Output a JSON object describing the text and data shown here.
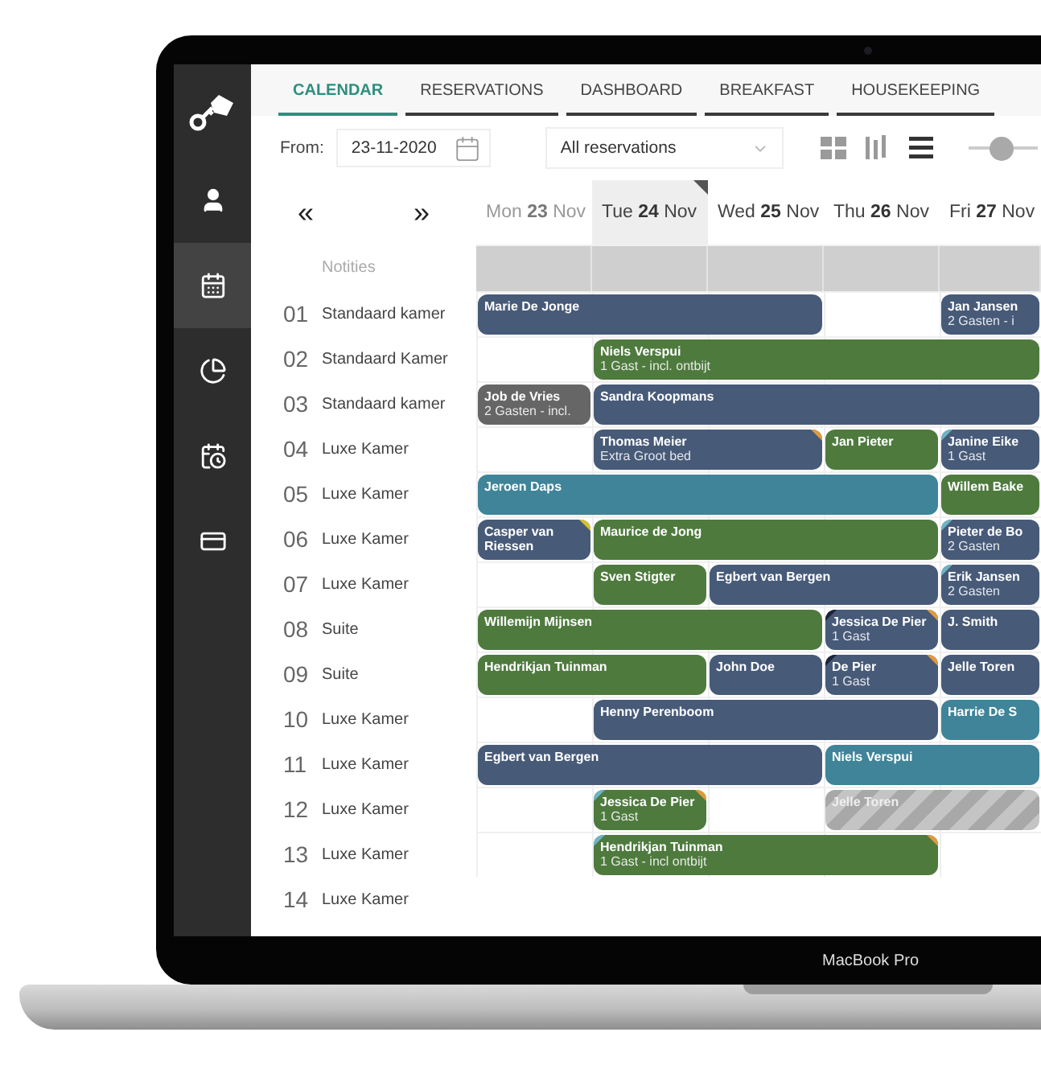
{
  "device": {
    "label": "MacBook Pro"
  },
  "sidebar": {
    "items": [
      {
        "kind": "guests",
        "selected": false
      },
      {
        "kind": "calendar",
        "selected": true
      },
      {
        "kind": "reports",
        "selected": false
      },
      {
        "kind": "schedule",
        "selected": false
      },
      {
        "kind": "payments",
        "selected": false
      }
    ]
  },
  "tabs": [
    {
      "label": "CALENDAR",
      "selected": true
    },
    {
      "label": "RESERVATIONS",
      "selected": false
    },
    {
      "label": "DASHBOARD",
      "selected": false
    },
    {
      "label": "BREAKFAST",
      "selected": false
    },
    {
      "label": "HOUSEKEEPING",
      "selected": false
    }
  ],
  "toolbar": {
    "from_label": "From:",
    "date": "23-11-2020",
    "filter": "All reservations",
    "views": [
      {
        "kind": "grid",
        "selected": false
      },
      {
        "kind": "columns",
        "selected": false
      },
      {
        "kind": "list",
        "selected": true
      }
    ],
    "zoom_slider": {
      "level": 0.45
    }
  },
  "nav": {
    "previous": "«",
    "next": "»"
  },
  "days": [
    {
      "weekday": "Mon",
      "day": "23",
      "month": "Nov",
      "selected": false,
      "past": true
    },
    {
      "weekday": "Tue",
      "day": "24",
      "month": "Nov",
      "selected": true,
      "past": false
    },
    {
      "weekday": "Wed",
      "day": "25",
      "month": "Nov",
      "selected": false,
      "past": false
    },
    {
      "weekday": "Thu",
      "day": "26",
      "month": "Nov",
      "selected": false,
      "past": false
    },
    {
      "weekday": "Fri",
      "day": "27",
      "month": "Nov",
      "selected": false,
      "past": false
    }
  ],
  "notes_label": "Notities",
  "rooms": [
    {
      "number": "01",
      "name": "Standaard kamer",
      "bookings": [
        {
          "kind": "booking",
          "guest": "Marie De Jonge",
          "color": "#475a78"
        },
        {
          "kind": "booking",
          "guest": "Jan Jansen",
          "detail": "2 Gasten - i",
          "color": "#475a78"
        }
      ]
    },
    {
      "number": "02",
      "name": "Standaard Kamer",
      "bookings": [
        {
          "kind": "booking",
          "guest": "Niels Verspui",
          "detail": "1 Gast - incl. ontbijt",
          "color": "#4e7a3e"
        }
      ]
    },
    {
      "number": "03",
      "name": "Standaard kamer",
      "bookings": [
        {
          "kind": "booking",
          "guest": "Job de Vries",
          "detail": "2 Gasten - incl.",
          "color": "#666666"
        },
        {
          "kind": "booking",
          "guest": "Sandra Koopmans",
          "color": "#475a78"
        }
      ]
    },
    {
      "number": "04",
      "name": "Luxe Kamer",
      "bookings": [
        {
          "kind": "booking",
          "guest": "Thomas Meier",
          "detail": "Extra Groot bed",
          "color": "#475a78",
          "end_flag": {
            "color": "#e09a3e"
          }
        },
        {
          "kind": "booking",
          "guest": "Jan Pieter",
          "color": "#4e7a3e"
        },
        {
          "kind": "booking",
          "guest": "Janine Eike",
          "detail": "1 Gast",
          "color": "#475a78",
          "start_flag": {
            "color": "#6fb3c4"
          }
        }
      ]
    },
    {
      "number": "05",
      "name": "Luxe Kamer",
      "bookings": [
        {
          "kind": "booking",
          "guest": "Jeroen Daps",
          "color": "#3f8499"
        },
        {
          "kind": "booking",
          "guest": "Willem Bake",
          "color": "#4e7a3e"
        }
      ]
    },
    {
      "number": "06",
      "name": "Luxe Kamer",
      "bookings": [
        {
          "kind": "booking",
          "guest": "Casper van Riessen",
          "color": "#475a78",
          "end_flag": {
            "color": "#d9c12a"
          }
        },
        {
          "kind": "booking",
          "guest": "Maurice de Jong",
          "color": "#4e7a3e"
        },
        {
          "kind": "booking",
          "guest": "Pieter de Bo",
          "detail": "2 Gasten",
          "color": "#475a78",
          "start_flag": {
            "color": "#6fb3c4"
          }
        }
      ]
    },
    {
      "number": "07",
      "name": "Luxe Kamer",
      "bookings": [
        {
          "kind": "booking",
          "guest": "Sven Stigter",
          "color": "#4e7a3e"
        },
        {
          "kind": "booking",
          "guest": "Egbert van Bergen",
          "color": "#475a78"
        },
        {
          "kind": "booking",
          "guest": "Erik Jansen",
          "detail": "2 Gasten",
          "color": "#475a78",
          "start_flag": {
            "color": "#6fb3c4"
          }
        }
      ]
    },
    {
      "number": "08",
      "name": "Suite",
      "bookings": [
        {
          "kind": "booking",
          "guest": "Willemijn Mijnsen",
          "color": "#4e7a3e"
        },
        {
          "kind": "booking",
          "guest": "Jessica De Pier",
          "detail": "1 Gast",
          "color": "#475a78",
          "start_flag": {
            "color": "#1b2438"
          },
          "end_flag": {
            "color": "#e09a3e"
          }
        },
        {
          "kind": "booking",
          "guest": "J. Smith",
          "color": "#475a78"
        }
      ]
    },
    {
      "number": "09",
      "name": "Suite",
      "bookings": [
        {
          "kind": "booking",
          "guest": "Hendrikjan Tuinman",
          "color": "#4e7a3e"
        },
        {
          "kind": "booking",
          "guest": "John Doe",
          "color": "#475a78"
        },
        {
          "kind": "booking",
          "guest": "De Pier",
          "detail": "1 Gast",
          "color": "#475a78",
          "start_flag": {
            "color": "#1b2438"
          },
          "end_flag": {
            "color": "#e09a3e"
          }
        },
        {
          "kind": "booking",
          "guest": "Jelle Toren",
          "color": "#475a78"
        }
      ]
    },
    {
      "number": "10",
      "name": "Luxe Kamer",
      "bookings": [
        {
          "kind": "booking",
          "guest": "Henny Perenboom",
          "color": "#475a78"
        },
        {
          "kind": "booking",
          "guest": "Harrie De S",
          "color": "#3f8499"
        }
      ]
    },
    {
      "number": "11",
      "name": "Luxe Kamer",
      "bookings": [
        {
          "kind": "booking",
          "guest": "Egbert van Bergen",
          "color": "#475a78"
        },
        {
          "kind": "booking",
          "guest": "Niels Verspui",
          "color": "#3f8499"
        }
      ]
    },
    {
      "number": "12",
      "name": "Luxe Kamer",
      "bookings": [
        {
          "kind": "booking",
          "guest": "Jessica De Pier",
          "detail": "1 Gast",
          "color": "#4e7a3e",
          "start_flag": {
            "color": "#6fb3c4"
          },
          "end_flag": {
            "color": "#e09a3e"
          }
        },
        {
          "kind": "blocked",
          "guest": "Jelle Toren",
          "color": "#a8a8a8"
        }
      ]
    },
    {
      "number": "13",
      "name": "Luxe Kamer",
      "bookings": [
        {
          "kind": "booking",
          "guest": "Hendrikjan Tuinman",
          "detail": "1 Gast - incl ontbijt",
          "color": "#4e7a3e",
          "start_flag": {
            "color": "#6fb3c4"
          },
          "end_flag": {
            "color": "#e09a3e"
          }
        }
      ]
    },
    {
      "number": "14",
      "name": "Luxe Kamer"
    }
  ]
}
